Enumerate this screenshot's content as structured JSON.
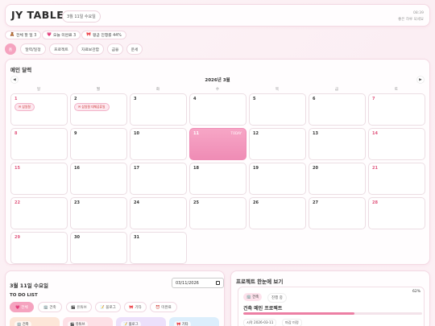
{
  "header": {
    "title": "JY TABLE",
    "date": "3월 11일 수요일",
    "time": "08:39",
    "greeting": "좋은 하루 되세요"
  },
  "stats": [
    {
      "icon": "🧸",
      "label": "전체 할 일 3"
    },
    {
      "icon": "💗",
      "label": "오늘 미완료 3"
    },
    {
      "icon": "🎀",
      "label": "평균 진행률 44%"
    }
  ],
  "nav": [
    {
      "label": "홈",
      "active": true
    },
    {
      "label": "달력/일정"
    },
    {
      "label": "프로젝트"
    },
    {
      "label": "자료보관함"
    },
    {
      "label": "금융"
    },
    {
      "label": "운세"
    }
  ],
  "calendar": {
    "title": "메인 달력",
    "month": "2026년 3월",
    "prev": "◀",
    "next": "▶",
    "weekdays": [
      "일",
      "월",
      "화",
      "수",
      "목",
      "금",
      "토"
    ],
    "today_label": "TODAY",
    "today_day": 11,
    "start_weekday": 0,
    "days_in_month": 31,
    "events": {
      "1": "✉ 삼일절",
      "2": "✉ 삼일절 대체공휴일"
    }
  },
  "todo": {
    "date_title": "3월 11일 수요일",
    "date_value": "03/11/2026",
    "list_title": "TO DO LIST",
    "filters": [
      {
        "label": "💗 전체",
        "active": true
      },
      {
        "label": "🏢 건축"
      },
      {
        "label": "🎬 유튜브"
      },
      {
        "label": "📝 블로그"
      },
      {
        "label": "🎀 기타"
      },
      {
        "label": "⏰ 미완료"
      }
    ],
    "cards": [
      {
        "label": "🏢 건축",
        "color": "#fde6d8"
      },
      {
        "label": "🎬 유튜브",
        "color": "#fde0e6"
      },
      {
        "label": "📝 블로그",
        "color": "#ece0fb"
      },
      {
        "label": "🎀 기타",
        "color": "#dceefc"
      }
    ]
  },
  "project": {
    "title": "프로젝트 한눈에 보기",
    "category": "🏢 건축",
    "status": "진행 중",
    "progress": 62,
    "progress_label": "62%",
    "name": "건축 메인 프로젝트",
    "start": "시작 2026-03-11",
    "end": "마감 미정"
  },
  "colors": {
    "accent": "#f5a3bf",
    "sunday": "#e0557d",
    "today": "#ef8cb5"
  }
}
